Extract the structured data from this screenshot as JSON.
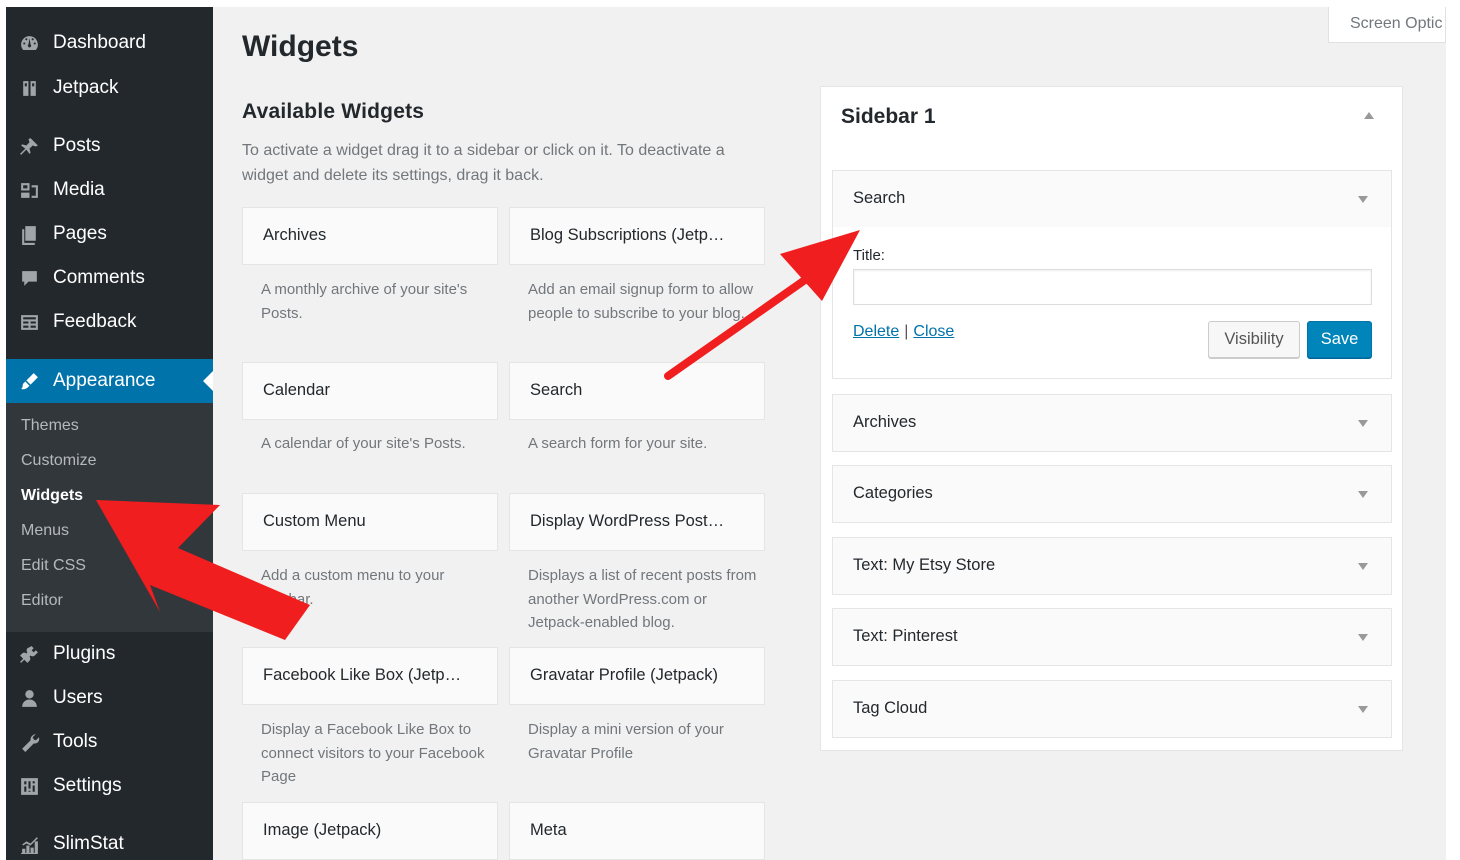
{
  "admin_menu": {
    "items": [
      {
        "label": "Dashboard",
        "icon": "dashboard-icon"
      },
      {
        "label": "Jetpack",
        "icon": "jetpack-icon"
      },
      {
        "label": "Posts",
        "icon": "pin-icon"
      },
      {
        "label": "Media",
        "icon": "media-icon"
      },
      {
        "label": "Pages",
        "icon": "pages-icon"
      },
      {
        "label": "Comments",
        "icon": "comment-icon"
      },
      {
        "label": "Feedback",
        "icon": "feedback-icon"
      },
      {
        "label": "Appearance",
        "icon": "brush-icon"
      },
      {
        "label": "Plugins",
        "icon": "plugin-icon"
      },
      {
        "label": "Users",
        "icon": "user-icon"
      },
      {
        "label": "Tools",
        "icon": "wrench-icon"
      },
      {
        "label": "Settings",
        "icon": "settings-icon"
      },
      {
        "label": "SlimStat",
        "icon": "chart-icon"
      }
    ],
    "current": "Appearance",
    "submenu": [
      "Themes",
      "Customize",
      "Widgets",
      "Menus",
      "Edit CSS",
      "Editor"
    ],
    "submenu_current": "Widgets"
  },
  "screen_options_label": "Screen Optic",
  "page_title": "Widgets",
  "available": {
    "title": "Available Widgets",
    "description": "To activate a widget drag it to a sidebar or click on it. To deactivate a widget and delete its settings, drag it back.",
    "widgets": [
      {
        "name": "Archives",
        "desc": "A monthly archive of your site's Posts."
      },
      {
        "name": "Blog Subscriptions (Jetp…",
        "desc": "Add an email signup form to allow people to subscribe to your blog."
      },
      {
        "name": "Calendar",
        "desc": "A calendar of your site's Posts."
      },
      {
        "name": "Search",
        "desc": "A search form for your site."
      },
      {
        "name": "Custom Menu",
        "desc": "Add a custom menu to your sidebar."
      },
      {
        "name": "Display WordPress Post…",
        "desc": "Displays a list of recent posts from another WordPress.com or Jetpack-enabled blog."
      },
      {
        "name": "Facebook Like Box (Jetp…",
        "desc": "Display a Facebook Like Box to connect visitors to your Facebook Page"
      },
      {
        "name": "Gravatar Profile (Jetpack)",
        "desc": "Display a mini version of your Gravatar Profile"
      },
      {
        "name": "Image (Jetpack)",
        "desc": ""
      },
      {
        "name": "Meta",
        "desc": ""
      }
    ]
  },
  "sidebar": {
    "title": "Sidebar 1",
    "widgets": [
      "Search",
      "Archives",
      "Categories",
      "Text: My Etsy Store",
      "Text: Pinterest",
      "Tag Cloud"
    ],
    "expanded": {
      "title_label": "Title:",
      "title_value": "",
      "delete_label": "Delete",
      "separator": "|",
      "close_label": "Close",
      "visibility_label": "Visibility",
      "save_label": "Save"
    }
  },
  "colors": {
    "menu_bg": "#23282d",
    "submenu_bg": "#32373c",
    "accent": "#0073aa",
    "save_button": "#0085ba",
    "arrow": "#f01e1e"
  }
}
